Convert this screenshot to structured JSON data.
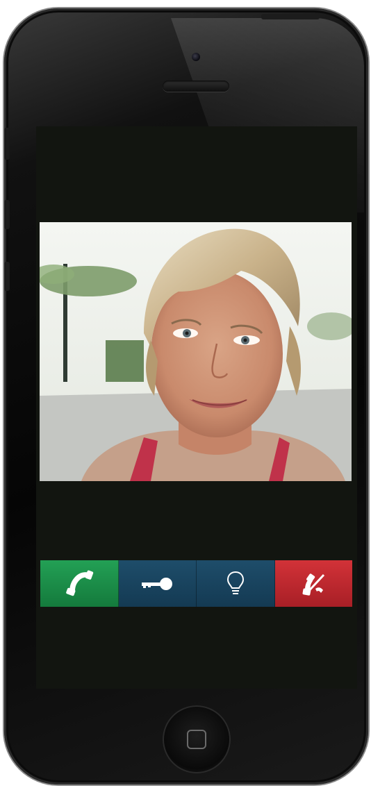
{
  "device": {
    "icons": {
      "answer": "phone-answer-icon",
      "door": "key-icon",
      "light": "light-bulb-icon",
      "hangup": "phone-hangup-icon",
      "home": "home-button"
    }
  },
  "call_controls": {
    "colors": {
      "answer": "#1b8c48",
      "door": "#184561",
      "light": "#184561",
      "hangup": "#bf2a30"
    }
  },
  "video": {
    "content": "video-feed-portrait"
  }
}
